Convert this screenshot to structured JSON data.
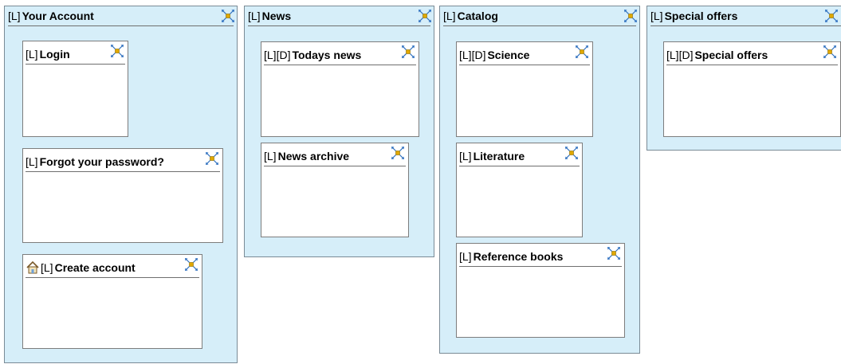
{
  "groups": [
    {
      "tag": "[L]",
      "title": "Your Account",
      "cards": [
        {
          "tag": "[L]",
          "title": "Login"
        },
        {
          "tag": "[L]",
          "title": "Forgot your password?"
        },
        {
          "tag": "[L]",
          "title": "Create account",
          "icon": "home-icon"
        }
      ]
    },
    {
      "tag": "[L]",
      "title": "News",
      "cards": [
        {
          "tag": "[L][D]",
          "title": "Todays news"
        },
        {
          "tag": "[L]",
          "title": "News archive"
        }
      ]
    },
    {
      "tag": "[L]",
      "title": "Catalog",
      "cards": [
        {
          "tag": "[L][D]",
          "title": "Science"
        },
        {
          "tag": "[L]",
          "title": "Literature"
        },
        {
          "tag": "[L]",
          "title": "Reference books"
        }
      ]
    },
    {
      "tag": "[L]",
      "title": "Special offers",
      "cards": [
        {
          "tag": "[L][D]",
          "title": "Special offers"
        }
      ]
    }
  ],
  "icons": {
    "drag_handle": "move-handle-icon",
    "home": "home-icon"
  },
  "colors": {
    "group_background": "#d6eef9",
    "card_background": "#ffffff",
    "handle_accent": "#e0a800",
    "handle_arrows": "#2d6fbf"
  }
}
